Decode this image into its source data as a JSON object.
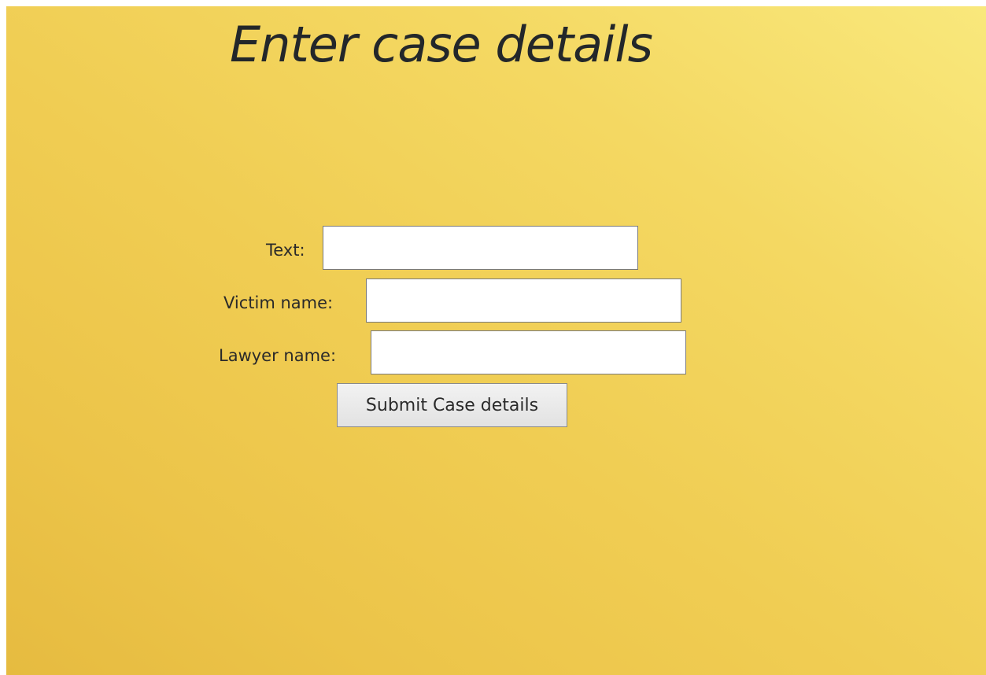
{
  "page": {
    "title": "Enter case details"
  },
  "form": {
    "text_label": "Text:",
    "text_value": "",
    "victim_label": "Victim name:",
    "victim_value": "",
    "lawyer_label": "Lawyer name:",
    "lawyer_value": "",
    "submit_label": "Submit Case details"
  },
  "colors": {
    "background_top_right": "#f9e87c",
    "background_bottom_left": "#e6bb40",
    "title_text": "#23272a"
  }
}
